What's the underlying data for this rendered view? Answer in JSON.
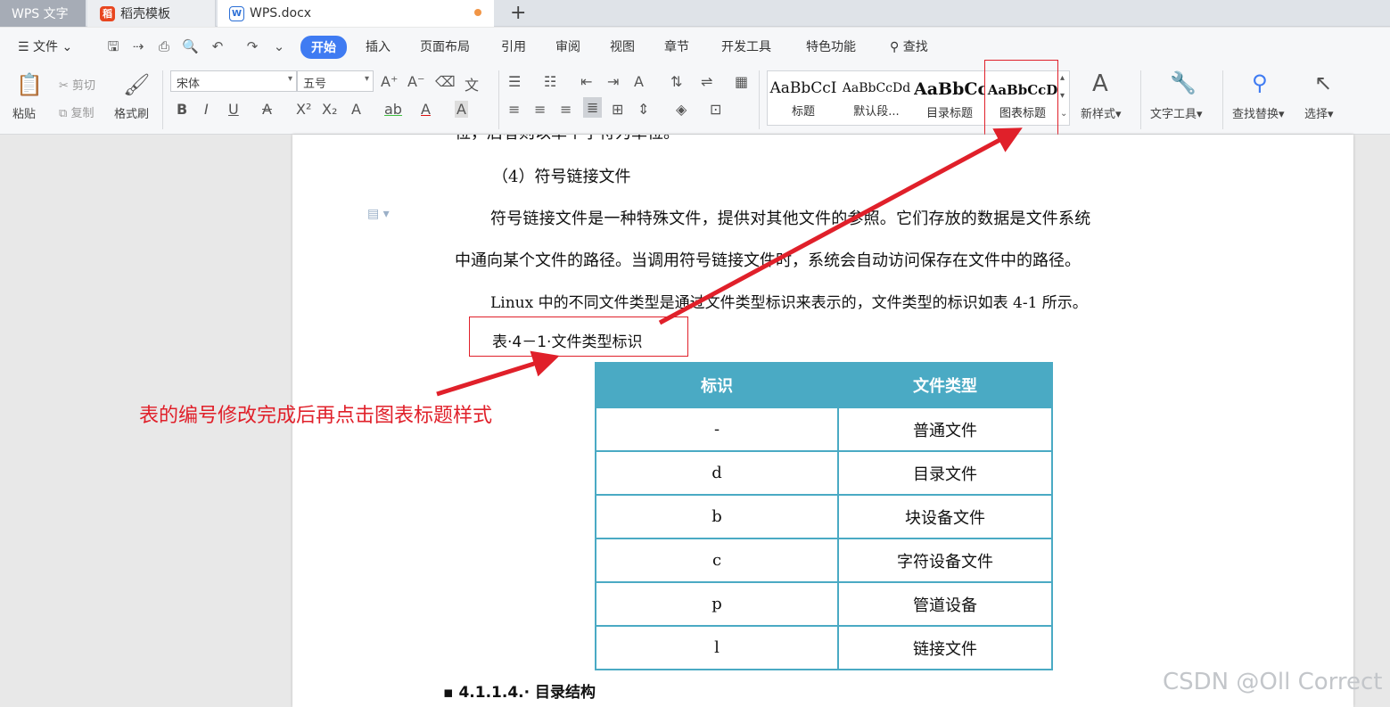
{
  "tabs": {
    "app": "WPS 文字",
    "docer": "稻壳模板",
    "document": "WPS.docx",
    "add": "+"
  },
  "menu": {
    "file": "文件",
    "items": [
      "开始",
      "插入",
      "页面布局",
      "引用",
      "审阅",
      "视图",
      "章节",
      "开发工具",
      "特色功能"
    ],
    "search": "查找"
  },
  "ribbon": {
    "paste": "粘贴",
    "cut": "剪切",
    "copy": "复制",
    "format_painter": "格式刷",
    "font_name": "宋体",
    "font_size": "五号",
    "styles": [
      {
        "sample": "AaBbCcI",
        "name": "标题"
      },
      {
        "sample": "AaBbCcDd",
        "name": "默认段..."
      },
      {
        "sample": "AaBbCc",
        "name": "目录标题"
      },
      {
        "sample": "AaBbCcD",
        "name": "图表标题"
      }
    ],
    "new_style": "新样式",
    "text_tools": "文字工具",
    "find_replace": "查找替换",
    "select": "选择"
  },
  "document": {
    "top_fragment": "位，后者则以单个字符为单位。",
    "heading_4": "（4）符号链接文件",
    "para1_line1": "符号链接文件是一种特殊文件，提供对其他文件的参照。它们存放的数据是文件系统",
    "para1_line2": "中通向某个文件的路径。当调用符号链接文件时，系统会自动访问保存在文件中的路径。",
    "para2": "Linux 中的不同文件类型是通过文件类型标识来表示的，文件类型的标识如表 4-1 所示。",
    "caption": "表·4－1·文件类型标识",
    "table": {
      "headers": [
        "标识",
        "文件类型"
      ],
      "rows": [
        [
          "-",
          "普通文件"
        ],
        [
          "d",
          "目录文件"
        ],
        [
          "b",
          "块设备文件"
        ],
        [
          "c",
          "字符设备文件"
        ],
        [
          "p",
          "管道设备"
        ],
        [
          "l",
          "链接文件"
        ]
      ]
    },
    "section_heading": "4.1.1.4.· 目录结构"
  },
  "annotation": "表的编号修改完成后再点击图表标题样式",
  "watermark": "CSDN @Oll Correct",
  "colors": {
    "accent": "#3f7bf2",
    "table_header": "#4aaac4",
    "annotation": "#e0202a"
  }
}
